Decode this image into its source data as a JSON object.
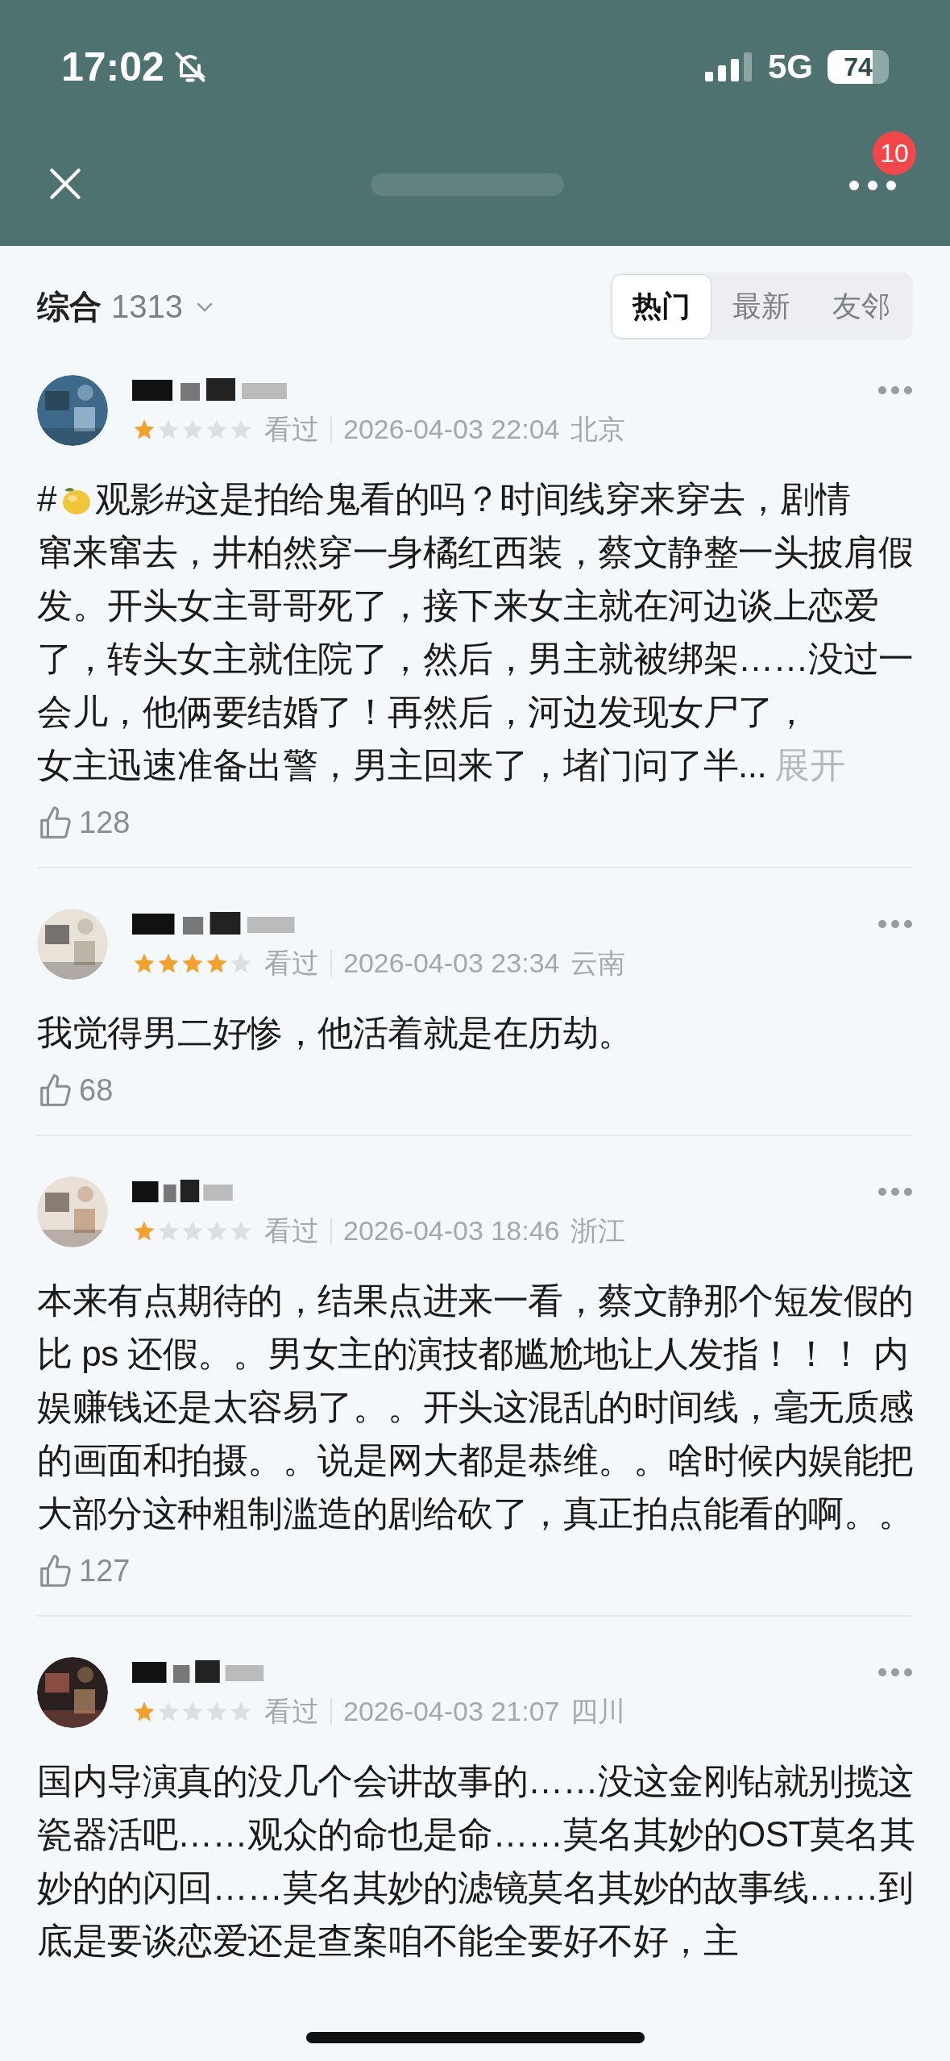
{
  "status_bar": {
    "time": "17:02",
    "network": "5G",
    "battery": "74"
  },
  "nav": {
    "badge": "10"
  },
  "filter": {
    "label": "综合",
    "count": "1313",
    "tabs": [
      {
        "label": "热门",
        "selected": true
      },
      {
        "label": "最新",
        "selected": false
      },
      {
        "label": "友邻",
        "selected": false
      }
    ]
  },
  "comments": [
    {
      "stars": 1,
      "watched": "看过",
      "time": "2026-04-03 22:04",
      "location": "北京",
      "segments": [
        {
          "kind": "text",
          "text": "#"
        },
        {
          "kind": "lemon"
        },
        {
          "kind": "text",
          "text": "观影#这是拍给鬼看的吗？时间线穿来穿去，剧情"
        },
        {
          "kind": "break"
        },
        {
          "kind": "text",
          "text": "窜来窜去，井柏然穿一身橘红西装，蔡文静整一头披肩假发。开头女主哥哥死了，接下来女主就在河边谈上恋爱了，转头女主就住院了，然后，男主就被绑架……没过一会儿，他俩要结婚了！再然后，河边发现女尸了，"
        },
        {
          "kind": "break"
        },
        {
          "kind": "text",
          "text": "女主迅速准备出警，男主回来了，堵门问了半..."
        }
      ],
      "expand": "展开",
      "likes": "128"
    },
    {
      "stars": 4,
      "watched": "看过",
      "time": "2026-04-03 23:34",
      "location": "云南",
      "segments": [
        {
          "kind": "text",
          "text": "我觉得男二好惨，他活着就是在历劫。"
        }
      ],
      "likes": "68"
    },
    {
      "stars": 1,
      "watched": "看过",
      "time": "2026-04-03 18:46",
      "location": "浙江",
      "segments": [
        {
          "kind": "text",
          "text": "本来有点期待的，结果点进来一看，蔡文静那个短发假的比 ps 还假。。男女主的演技都尴尬地让人发指！！！ 内娱赚钱还是太容易了。。开头这混乱的时间线，毫无质感的画面和拍摄。。说是网大都是恭维。。啥时候内娱能把大部分这种粗制滥造的剧给砍了，真正拍点能看的啊。。"
        }
      ],
      "likes": "127"
    },
    {
      "stars": 1,
      "watched": "看过",
      "time": "2026-04-03 21:07",
      "location": "四川",
      "segments": [
        {
          "kind": "text",
          "text": "国内导演真的没几个会讲故事的……没这金刚钻就别揽这瓷器活吧……观众的命也是命……莫名其妙的OST莫名其妙的的闪回……莫名其妙的滤镜莫名其妙的故事线……到底是要谈恋爱还是查案咱不能全要好不好，主"
        }
      ]
    }
  ]
}
